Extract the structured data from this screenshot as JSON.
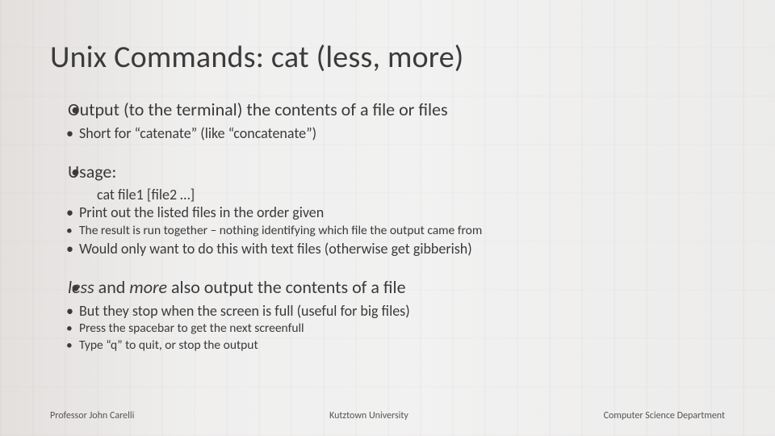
{
  "title": "Unix Commands: cat (less, more)",
  "block1": {
    "main": "Output (to the terminal) the contents of a file or files",
    "sub": "Short for “catenate” (like “concatenate”)"
  },
  "block2": {
    "main": "Usage:",
    "usage_line": "cat file1 [file2 …]",
    "print_line": "Print out the listed files in the order given",
    "print_sub": "The result is run together – nothing identifying which file the output came from",
    "text_files": "Would only want to do this with text files (otherwise get gibberish)"
  },
  "block3": {
    "main_pre": "less",
    "main_mid": " and ",
    "main_cmd2": "more",
    "main_post": " also output the contents of a file",
    "stop_full": "But they stop when the screen is full (useful for big files)",
    "space": "Press the spacebar to get the next screenfull",
    "quit": "Type “q” to quit, or stop the output"
  },
  "footer": {
    "left": "Professor John Carelli",
    "center": "Kutztown University",
    "right": "Computer Science Department"
  }
}
